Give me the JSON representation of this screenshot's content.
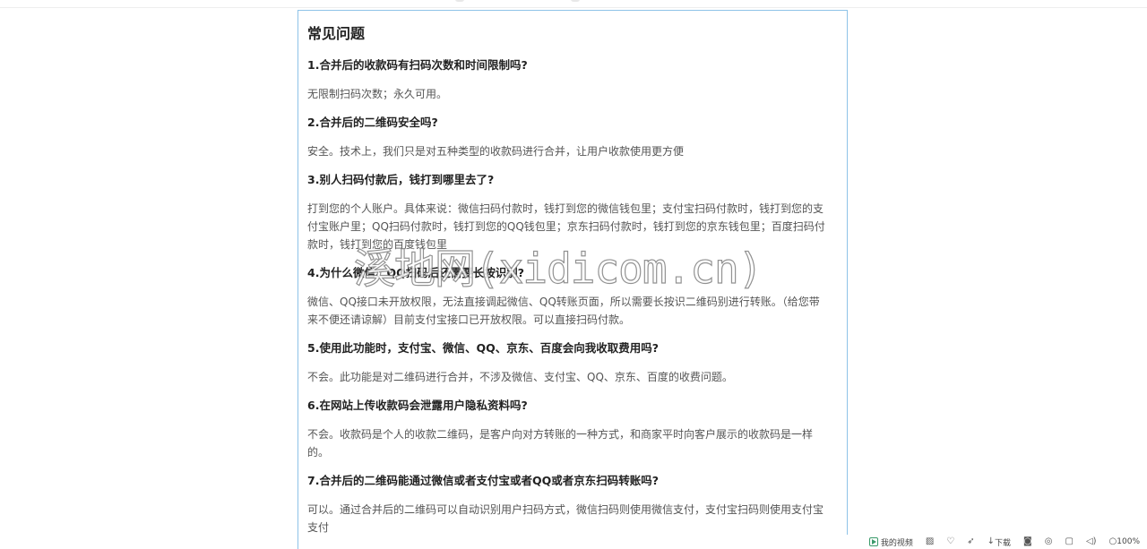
{
  "faq": {
    "title": "常见问题",
    "items": [
      {
        "q": "1.合并后的收款码有扫码次数和时间限制吗?",
        "a": "无限制扫码次数；永久可用。"
      },
      {
        "q": "2.合并后的二维码安全吗?",
        "a": "安全。技术上，我们只是对五种类型的收款码进行合并，让用户收款使用更方便"
      },
      {
        "q": "3.别人扫码付款后，钱打到哪里去了?",
        "a": "打到您的个人账户。具体来说：微信扫码付款时，钱打到您的微信钱包里；支付宝扫码付款时，钱打到您的支付宝账户里；QQ扫码付款时，钱打到您的QQ钱包里；京东扫码付款时，钱打到您的京东钱包里；百度扫码付款时，钱打到您的百度钱包里"
      },
      {
        "q": "4.为什么微信、QQ扫码后还需要长按识别?",
        "a": "微信、QQ接口未开放权限，无法直接调起微信、QQ转账页面，所以需要长按识二维码别进行转账。（给您带来不便还请谅解）目前支付宝接口已开放权限。可以直接扫码付款。"
      },
      {
        "q": "5.使用此功能时，支付宝、微信、QQ、京东、百度会向我收取费用吗?",
        "a": "不会。此功能是对二维码进行合并，不涉及微信、支付宝、QQ、京东、百度的收费问题。"
      },
      {
        "q": "6.在网站上传收款码会泄露用户隐私资料吗?",
        "a": "不会。收款码是个人的收款二维码，是客户向对方转账的一种方式，和商家平时向客户展示的收款码是一样的。"
      },
      {
        "q": "7.合并后的二维码能通过微信或者支付宝或者QQ或者京东扫码转账吗?",
        "a": "可以。通过合并后的二维码可以自动识别用户扫码方式，微信扫码则使用微信支付，支付宝扫码则使用支付宝支付"
      }
    ]
  },
  "watermark": {
    "text": "溪地网(xidicom.cn)"
  },
  "statusbar": {
    "my_video": "我的视频",
    "download": "下载",
    "zoom": "100%"
  }
}
